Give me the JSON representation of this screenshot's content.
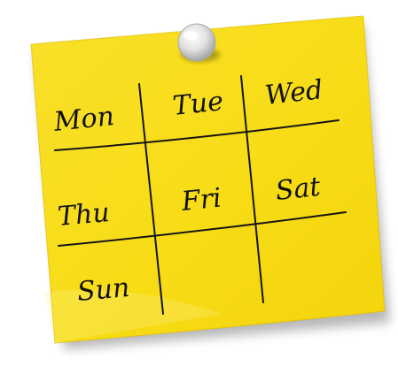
{
  "note": {
    "days": {
      "mon": "Mon",
      "tue": "Tue",
      "wed": "Wed",
      "thu": "Thu",
      "fri": "Fri",
      "sat": "Sat",
      "sun": "Sun"
    },
    "colors": {
      "paper": "#f6dc1a",
      "paper_light": "#fae63a",
      "ink": "#111111",
      "pin": "#d9d9d9"
    },
    "icon": "pushpin-icon"
  }
}
